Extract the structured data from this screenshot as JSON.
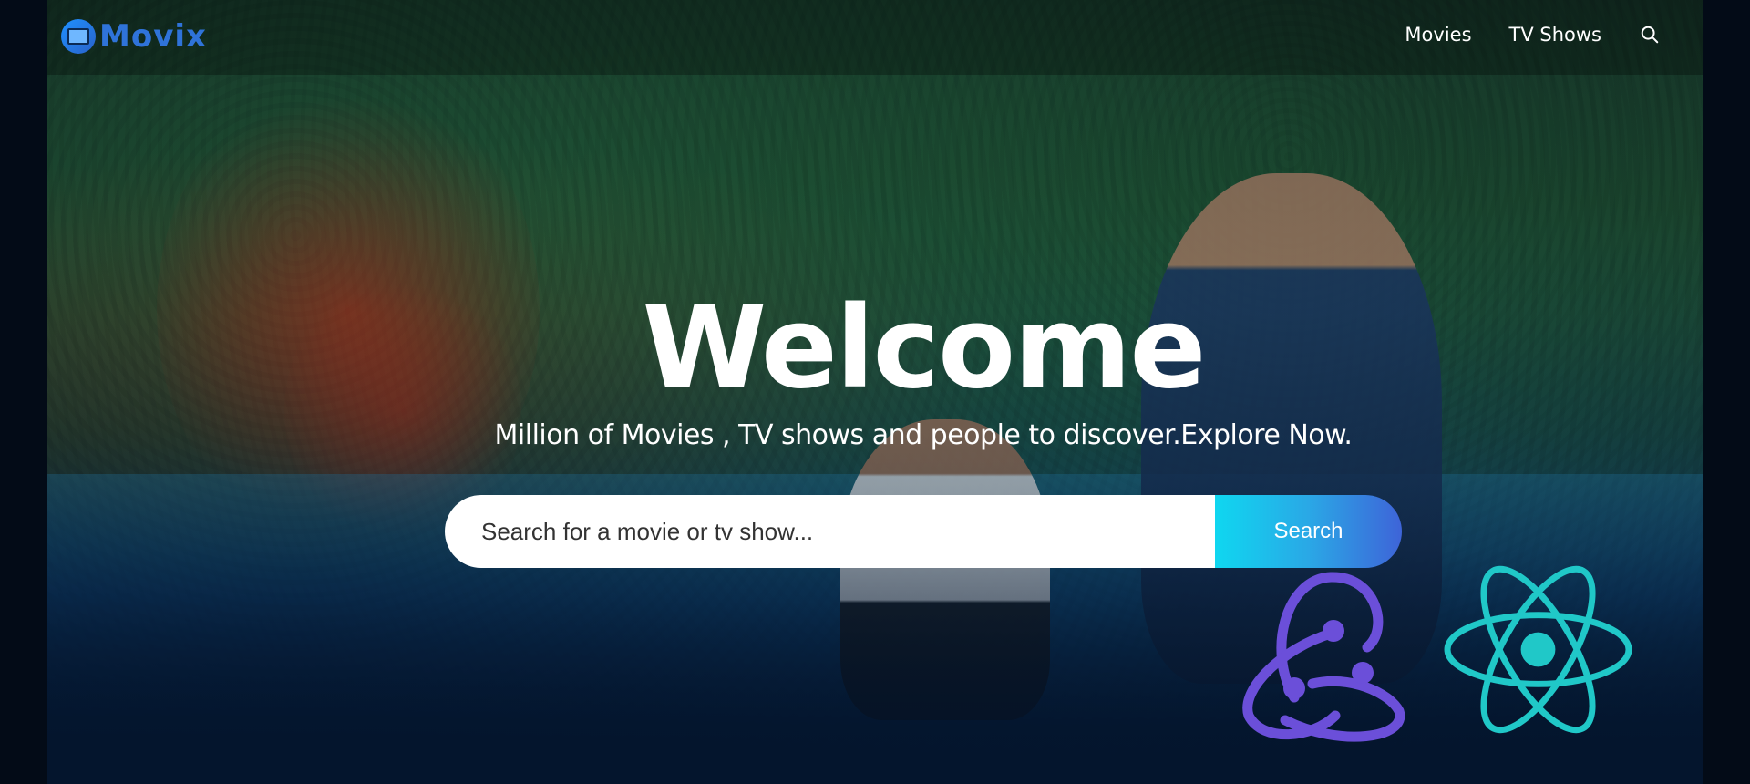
{
  "app": {
    "logo_text": "Movix"
  },
  "header": {
    "nav": [
      {
        "label": "Movies"
      },
      {
        "label": "TV Shows"
      }
    ],
    "search_icon": "search-icon"
  },
  "hero": {
    "title": "Welcome",
    "subtitle": "Million of Movies , TV shows and people to discover.Explore Now.",
    "search": {
      "placeholder": "Search for a movie or tv show...",
      "value": "",
      "button_label": "Search"
    }
  },
  "badges": [
    {
      "icon": "redux-logo-icon",
      "color": "#764abc"
    },
    {
      "icon": "react-logo-icon",
      "color": "#20c8c8"
    }
  ],
  "colors": {
    "background": "#04152d",
    "brand": "#2f73d9",
    "button_gradient_start": "#0fd7f0",
    "button_gradient_end": "#3e64d8"
  }
}
